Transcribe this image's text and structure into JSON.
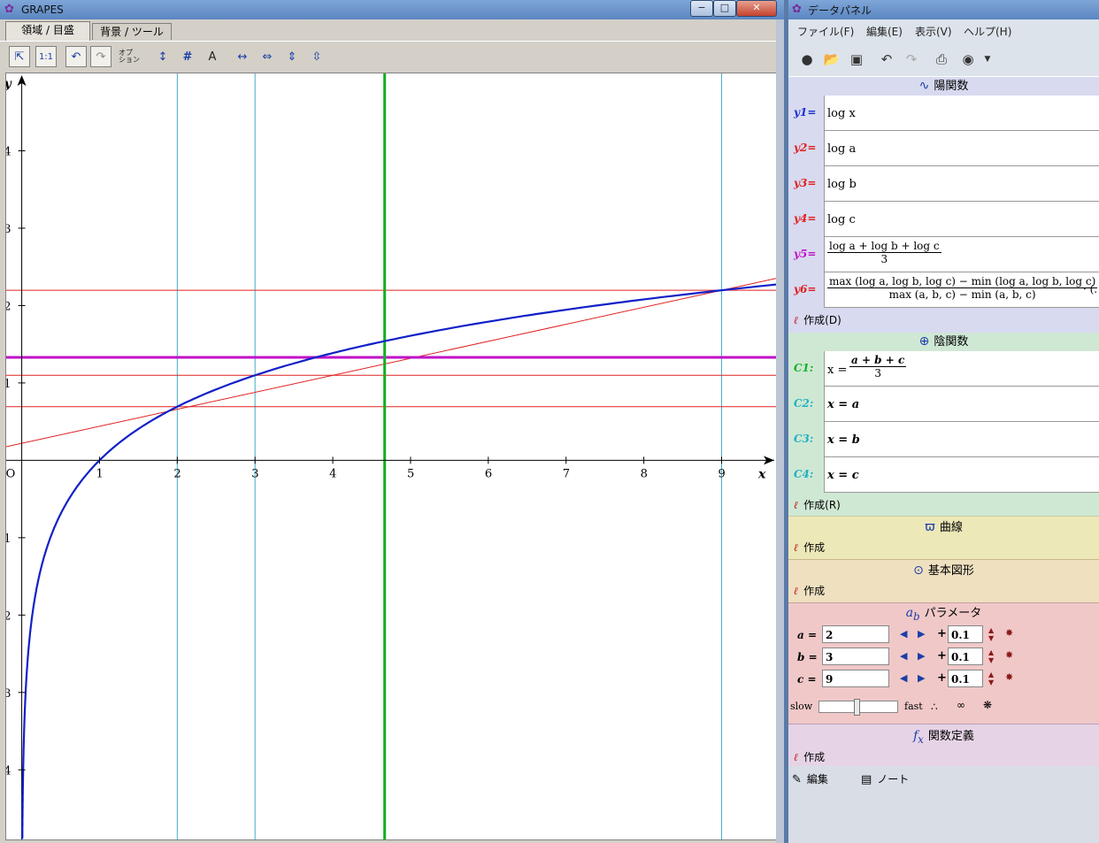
{
  "grapes": {
    "title": "GRAPES",
    "window_buttons": [
      "−",
      "□",
      "✕"
    ],
    "tabs": [
      "領域 / 目盛",
      "背景 / ツール"
    ],
    "toolbar_option_label": "オプ\nション",
    "toolbar_ratio_label": "1:1"
  },
  "graph": {
    "origin_label": "O",
    "x_axis_label": "x",
    "y_axis_label": "y",
    "x_ticks": [
      "1",
      "2",
      "3",
      "4",
      "5",
      "6",
      "7",
      "8",
      "9"
    ],
    "y_ticks": [
      "4",
      "3",
      "2",
      "1",
      "−1",
      "−2",
      "−3",
      "−4"
    ],
    "x_range": [
      -0.2,
      9.7
    ],
    "y_range": [
      -4.9,
      5.0
    ],
    "colors": {
      "curve": "#1020c8",
      "thin": "#e02020",
      "cyan": "#40b0c8",
      "green": "#10b020",
      "magenta": "#c010c8"
    },
    "params": {
      "a": 2,
      "b": 3,
      "c": 9
    },
    "vertical_lines_x": [
      2,
      3,
      9
    ],
    "mean_x": 4.6667,
    "horizontal_lines_y": [
      0.6931,
      1.0986,
      2.1972
    ],
    "mean_log_y": 1.3297,
    "secant": {
      "slope": 0.2197,
      "intercept": 0.2197
    }
  },
  "panel": {
    "title": "データパネル",
    "menu": [
      "ファイル(F)",
      "編集(E)",
      "表示(V)",
      "ヘルプ(H)"
    ],
    "explicit": {
      "header": "陽関数",
      "rows": [
        {
          "label": "y1=",
          "color": "#1a2fd0",
          "expr": "log x"
        },
        {
          "label": "y2=",
          "color": "#e02020",
          "expr": "log a"
        },
        {
          "label": "y3=",
          "color": "#e02020",
          "expr": "log b"
        },
        {
          "label": "y4=",
          "color": "#e02020",
          "expr": "log c"
        },
        {
          "label": "y5=",
          "color": "#c010c8",
          "num": "log a + log b + log c",
          "den": "3"
        },
        {
          "label": "y6=",
          "color": "#e02020",
          "num": "max (log a, log b, log c) − min (log a, log b, log c)",
          "den": "max (a, b, c) − min (a, b, c)",
          "tail": "· (."
        }
      ],
      "make": "作成(D)"
    },
    "implicit": {
      "header": "陰関数",
      "rows": [
        {
          "label": "C1:",
          "color": "#10b020",
          "lhs": "x =",
          "num": "a + b + c",
          "den": "3"
        },
        {
          "label": "C2:",
          "color": "#20b0c0",
          "expr": "x = a"
        },
        {
          "label": "C3:",
          "color": "#20b0c0",
          "expr": "x = b"
        },
        {
          "label": "C4:",
          "color": "#20b0c0",
          "expr": "x = c"
        }
      ],
      "make": "作成(R)"
    },
    "curve": {
      "header": "曲線",
      "make": "作成"
    },
    "shapes": {
      "header": "基本図形",
      "make": "作成"
    },
    "params": {
      "header": "パラメータ",
      "rows": [
        {
          "label": "a =",
          "value": "2",
          "step": "0.1"
        },
        {
          "label": "b =",
          "value": "3",
          "step": "0.1"
        },
        {
          "label": "c =",
          "value": "9",
          "step": "0.1"
        }
      ],
      "slow": "slow",
      "fast": "fast",
      "slider_level": 0.48
    },
    "funcdef": {
      "header": "関数定義",
      "make": "作成"
    },
    "bottom": {
      "edit": "編集",
      "note": "ノート"
    }
  }
}
